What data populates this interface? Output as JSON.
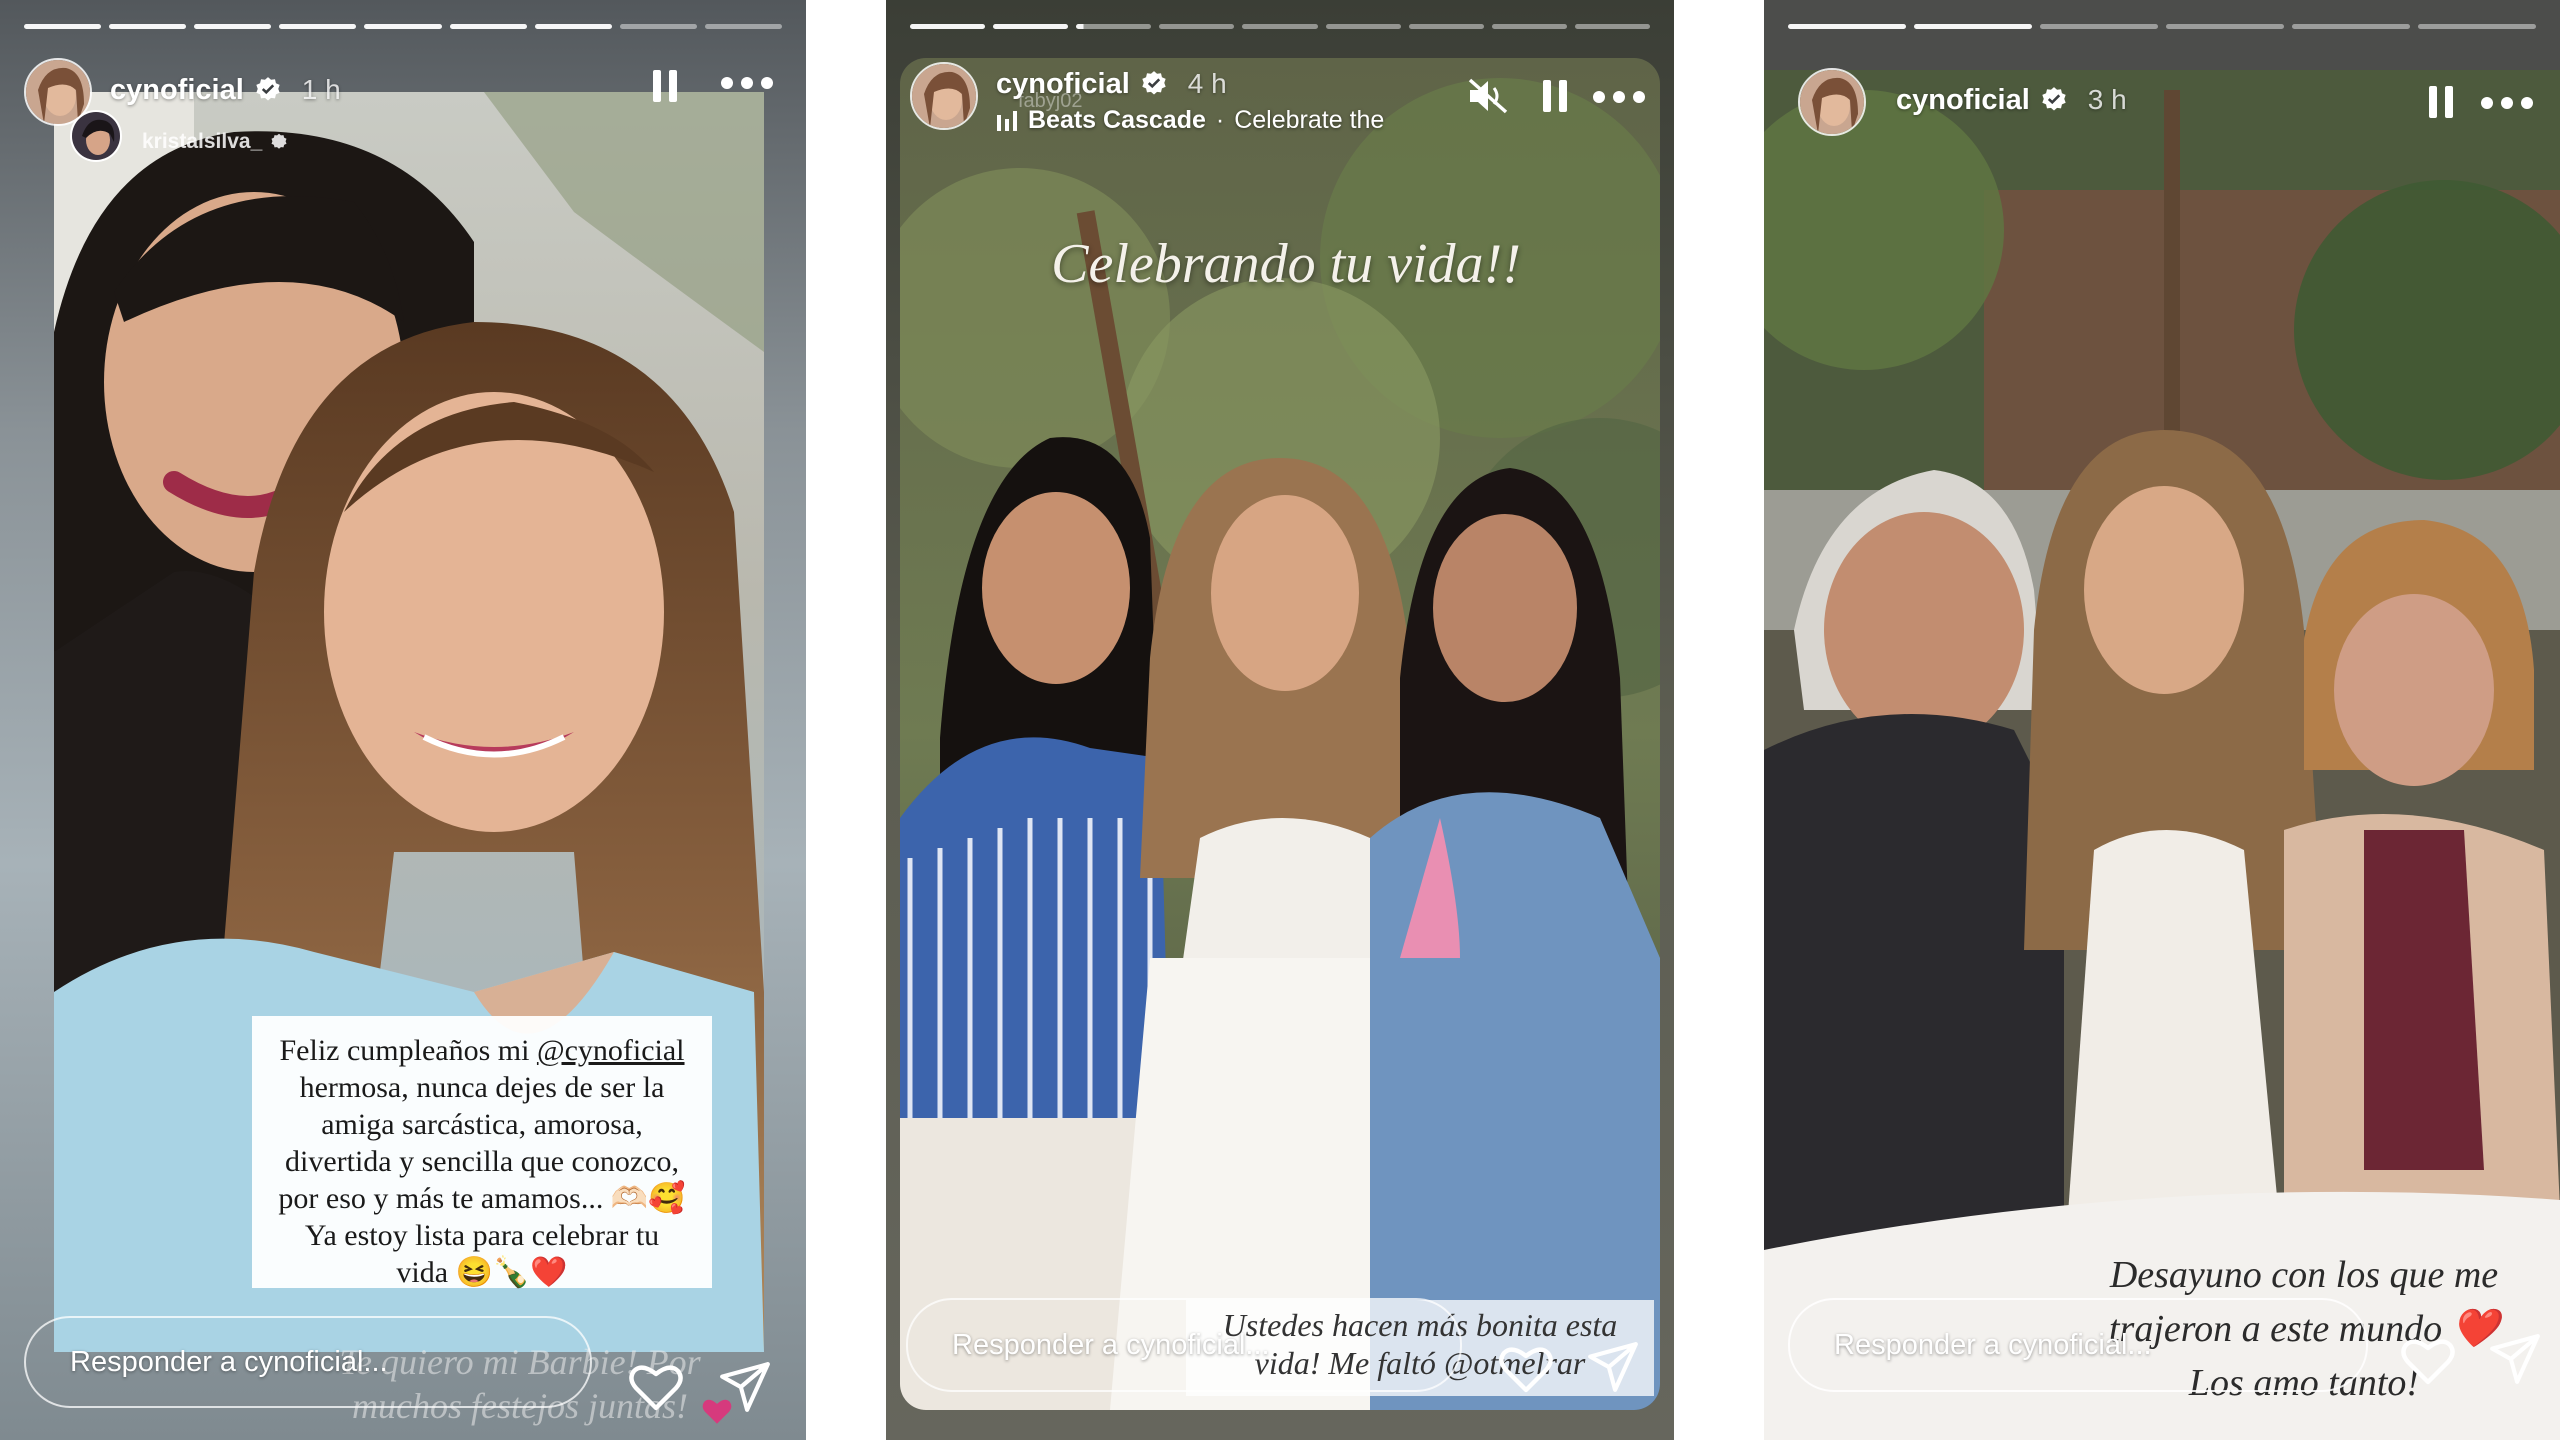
{
  "stories": [
    {
      "username": "cynoficial",
      "time": "1 h",
      "mention_user": "kristalsilva_",
      "caption_lines": [
        {
          "pre": "Feliz cumpleaños mi ",
          "mention": "@cynoficial"
        },
        {
          "pre": "hermosa, nunca dejes de ser la"
        },
        {
          "pre": "amiga sarcástica, amorosa,"
        },
        {
          "pre": "divertida y sencilla que conozco,"
        },
        {
          "pre": "por eso y más te amamos... 🫶🏻🥰"
        },
        {
          "pre": "Ya estoy lista para celebrar tu"
        },
        {
          "pre": "vida 😆🍾❤️"
        }
      ],
      "faded_text": [
        "Te quiero mi Barbie! Por",
        "muchos festejos juntas!"
      ],
      "reply_placeholder": "Responder a cynoficial..."
    },
    {
      "username": "cynoficial",
      "time": "4 h",
      "overlay_user": "fabyj02",
      "music_artist": "Beats Cascade",
      "music_sep": "·",
      "music_title": "Celebrate the",
      "script_title": "Celebrando tu vida!!",
      "bottom_text": [
        "Ustedes hacen más bonita esta",
        "vida! Me faltó @otmelrar"
      ],
      "reply_placeholder": "Responder a cynoficial..."
    },
    {
      "username": "cynoficial",
      "time": "3 h",
      "bottom_text": [
        "Desayuno con los que me",
        "trajeron a este mundo ❤️",
        "Los amo tanto!"
      ],
      "reply_placeholder": "Responder a cynoficial..."
    }
  ],
  "icons": {
    "pause": "pause-icon",
    "more": "more-icon",
    "mute": "mute-icon",
    "verified": "verified-badge-icon",
    "heart": "heart-icon",
    "send": "send-icon"
  },
  "progress": {
    "story1": {
      "segments": 9,
      "completed": 7
    },
    "story2": {
      "segments": 9,
      "completed": 2,
      "current_fraction": 0.1
    },
    "story3": {
      "segments": 6,
      "completed": 2
    }
  },
  "colors": {
    "verified": "#ffffff",
    "heart_emoji": "#d63a7d"
  }
}
